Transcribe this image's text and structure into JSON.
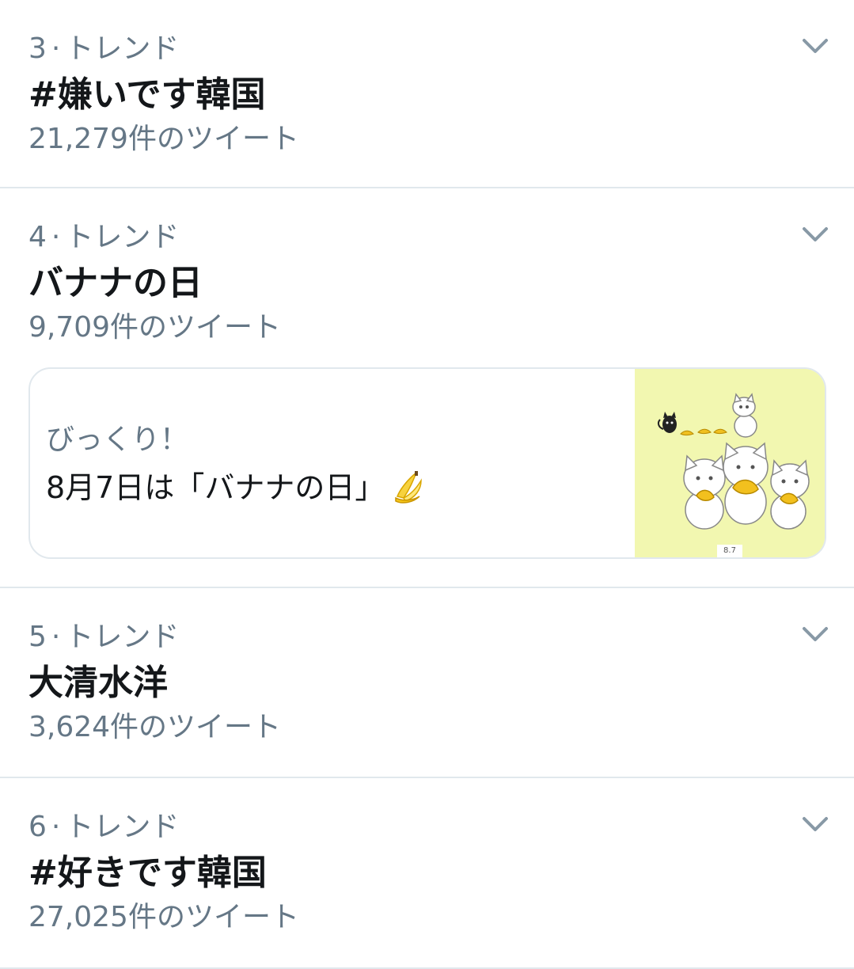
{
  "trends": [
    {
      "rank": "3",
      "separator": "·",
      "label": "トレンド",
      "name": "#嫌いです韓国",
      "count": "21,279件のツイート",
      "menu_icon": "chevron-down-icon"
    },
    {
      "rank": "4",
      "separator": "·",
      "label": "トレンド",
      "name": "バナナの日",
      "count": "9,709件のツイート",
      "menu_icon": "chevron-down-icon",
      "card": {
        "subtitle": "びっくり！",
        "headline": "8月7日は「バナナの日」",
        "emoji_icon": "banana-icon",
        "image_caption": "8.7",
        "image_background": "#f2f7b0"
      }
    },
    {
      "rank": "5",
      "separator": "·",
      "label": "トレンド",
      "name": "大清水洋",
      "count": "3,624件のツイート",
      "menu_icon": "chevron-down-icon"
    },
    {
      "rank": "6",
      "separator": "·",
      "label": "トレンド",
      "name": "#好きです韓国",
      "count": "27,025件のツイート",
      "menu_icon": "chevron-down-icon"
    }
  ],
  "colors": {
    "primary_text": "#14171a",
    "secondary_text": "#657786",
    "divider": "#e1e8ed",
    "chevron": "#8899a6"
  }
}
